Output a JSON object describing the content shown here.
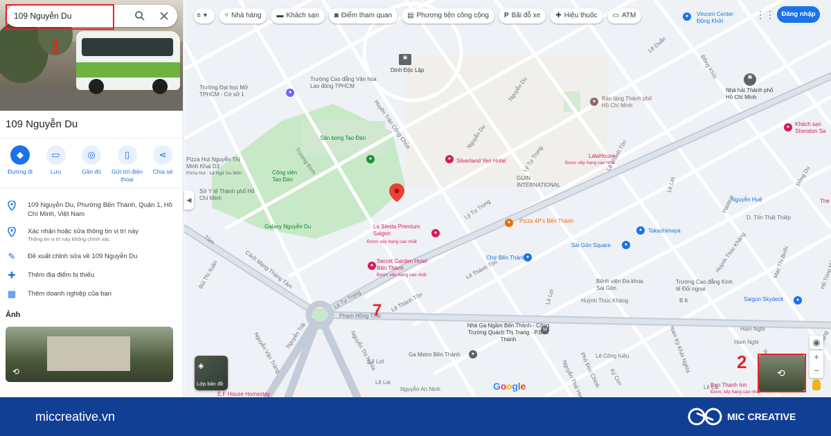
{
  "search": {
    "value": "109 Nguyễn Du"
  },
  "place": {
    "title": "109 Nguyễn Du"
  },
  "actions": [
    {
      "label": "Đường đi",
      "icon": "directions-icon"
    },
    {
      "label": "Lưu",
      "icon": "bookmark-icon"
    },
    {
      "label": "Gần đó",
      "icon": "nearby-icon"
    },
    {
      "label": "Gửi tới điện thoại",
      "icon": "phone-icon"
    },
    {
      "label": "Chia sẻ",
      "icon": "share-icon"
    }
  ],
  "info": {
    "address": "109 Nguyễn Du, Phường Bến Thành, Quận 1, Hồ Chí Minh, Việt Nam",
    "verify": "Xác nhận hoặc sửa thông tin vị trí này",
    "verify_sub": "Thông tin vị trí này không chính xác",
    "suggest": "Đề xuất chỉnh sửa về 109 Nguyễn Du",
    "add_missing": "Thêm địa điểm bị thiếu",
    "add_business": "Thêm doanh nghiệp của bạn"
  },
  "photos_label": "Ảnh",
  "chips": [
    {
      "label": "Nhà hàng",
      "icon": "restaurant-icon"
    },
    {
      "label": "Khách sạn",
      "icon": "hotel-icon"
    },
    {
      "label": "Điểm tham quan",
      "icon": "camera-icon"
    },
    {
      "label": "Phương tiện công cộng",
      "icon": "transit-icon"
    },
    {
      "label": "Bãi đỗ xe",
      "icon": "parking-icon"
    },
    {
      "label": "Hiệu thuốc",
      "icon": "pharmacy-icon"
    },
    {
      "label": "ATM",
      "icon": "atm-icon"
    }
  ],
  "signin": "Đăng nhập",
  "layers_label": "Lớp bản đồ",
  "annotations": [
    "1",
    "2",
    "7"
  ],
  "map_labels": {
    "dinh_doc_lap": "Dinh Độc Lập",
    "truong_cd": "Trường Cao đẳng Văn hóa Lao động TPHCM",
    "truong_dh": "Trường Đại học Mở TPHCM - Cơ sở 1",
    "san_bong": "Sân bóng Tao Đàn",
    "cong_vien": "Công viên Tao Đàn",
    "so_y_te": "Sở Y tế Thành phố Hồ Chí Minh",
    "pizza_hut": "Pizza Hut Nguyễn Thị Minh Khai D3",
    "pizza_hut_sub": "Pizza Hut · Lê Ngữ Du Mốn",
    "galaxy": "Galaxy Nguyễn Du",
    "la_siesta": "La Siesta Premium Saigon",
    "la_siesta_sub": "Được xếp hạng cao nhất",
    "secret_garden": "Secret Garden Hotel Bến Thành",
    "secret_garden_sub": "Được xếp hạng cao nhất",
    "silverland": "Silverland Yen Hotel",
    "lalahouse": "LalaHouse",
    "lalahouse_sub": "Được xếp hạng cao nhất",
    "guin": "GUIN INTERNATIONAL",
    "pizza4ps": "Pizza 4P's Bến Thành",
    "cho_ben_thanh": "Chợ Bến Thành",
    "takashimaya": "Takashimaya",
    "saigon_square": "Sài Gòn Square",
    "bao_tang": "Bảo tàng Thành phố Hồ Chí Minh",
    "vincom": "Vincom Center Đồng Khởi",
    "nha_hat": "Nhà hát Thành phố Hồ Chí Minh",
    "khach_san": "Khách sạn Sheraton Sa",
    "nguyen_hue": "Nguyễn Huệ",
    "benh_vien": "Bệnh viện Đa khoa Sài Gòn",
    "truong_cao_dang": "Trường Cao đẳng Kinh tế Đối ngoại",
    "saigon_skydeck": "Saigon Skydeck",
    "ga_ben_thanh": "Nhà Ga Ngầm Bến Thành - Công Trường Quách Thị Trang - P.Bến Thành",
    "ga_metro": "Ga Metro Bến Thành",
    "ben_thanh_inn": "Ben Thanh Inn",
    "ben_thanh_inn_sub": "Được xếp hạng cao nhất",
    "ef_house": "E.F House Homestay",
    "ham_nghi_1": "Hàm Nghi",
    "ham_nghi_2": "Hàm Nghi",
    "b_8": "B 8",
    "the_r": "The R",
    "nguyen_du_1": "Nguyễn Du",
    "nguyen_du_2": "Nguyễn Du",
    "huyen_tran": "Huyền Trân Công Chúa",
    "truong_dinh": "Trương Định",
    "ly_tu_trong_1": "Lý Tự Trọng",
    "ly_tu_trong_2": "Lý Tự Trọng",
    "ly_tu_trong_3": "Lý Tự Trọng",
    "le_thanh_ton_1": "Lê Thánh Tôn",
    "le_thanh_ton_2": "Lê Thánh Tôn",
    "le_thanh_ton_3": "Lê Thánh Tôn",
    "le_loi_1": "Lê Lợi",
    "le_loi_2": "Lê Lợi",
    "le_loi_3": "Lê Lợi",
    "pham_hong_thai": "Phạm Hồng Thái",
    "cach_mang": "Cách Mạng Tháng Tám",
    "nguyen_trai": "Nguyễn Trãi",
    "nguyen_thi_nghia": "Nguyễn Thị Nghĩa",
    "nguyen_van_trang": "Nguyễn Văn Tráng",
    "bui_thi_xuan": "Bùi Thị Xuân",
    "huynh_thuc_khang_1": "Huỳnh Thúc Kháng",
    "huynh_thuc_khang_2": "Huỳnh Thúc Kháng",
    "nam_ky": "Nam Kỳ Khởi Nghĩa",
    "ton_that_thiep": "D. Tôn Thất Thiệp",
    "dong_khoi": "Đồng Khởi",
    "pasteur": "Pasteur",
    "le_cong_kieu": "Lê Công Kiều",
    "yersin": "Yersin",
    "ky_con": "Ký Con",
    "pho_duc_chinh": "Phó Đức Chính",
    "nguyen_thai_hoc": "Nguyễn Thái Học",
    "ho_tung_mau": "Hồ Tùng Mậu",
    "ton_duc_thang": "Tôn Đức Thắng",
    "le_lai_1": "Lê Lai",
    "le_lai_2": "Lê Lai",
    "nguyen_an_ninh": "Nguyễn An Ninh",
    "tam": "Tám",
    "le_duan": "Lê Duẩn",
    "dong_du": "Đông Du",
    "mac_thi_buoi": "Mạc Thị Bưởi"
  },
  "google_logo": "Google",
  "footer": {
    "domain": "miccreative.vn",
    "brand": "MIC CREATIVE"
  },
  "colors": {
    "accent": "#1a73e8",
    "annotation": "#e4232a",
    "footer": "#113f94",
    "pin": "#ea4335"
  }
}
